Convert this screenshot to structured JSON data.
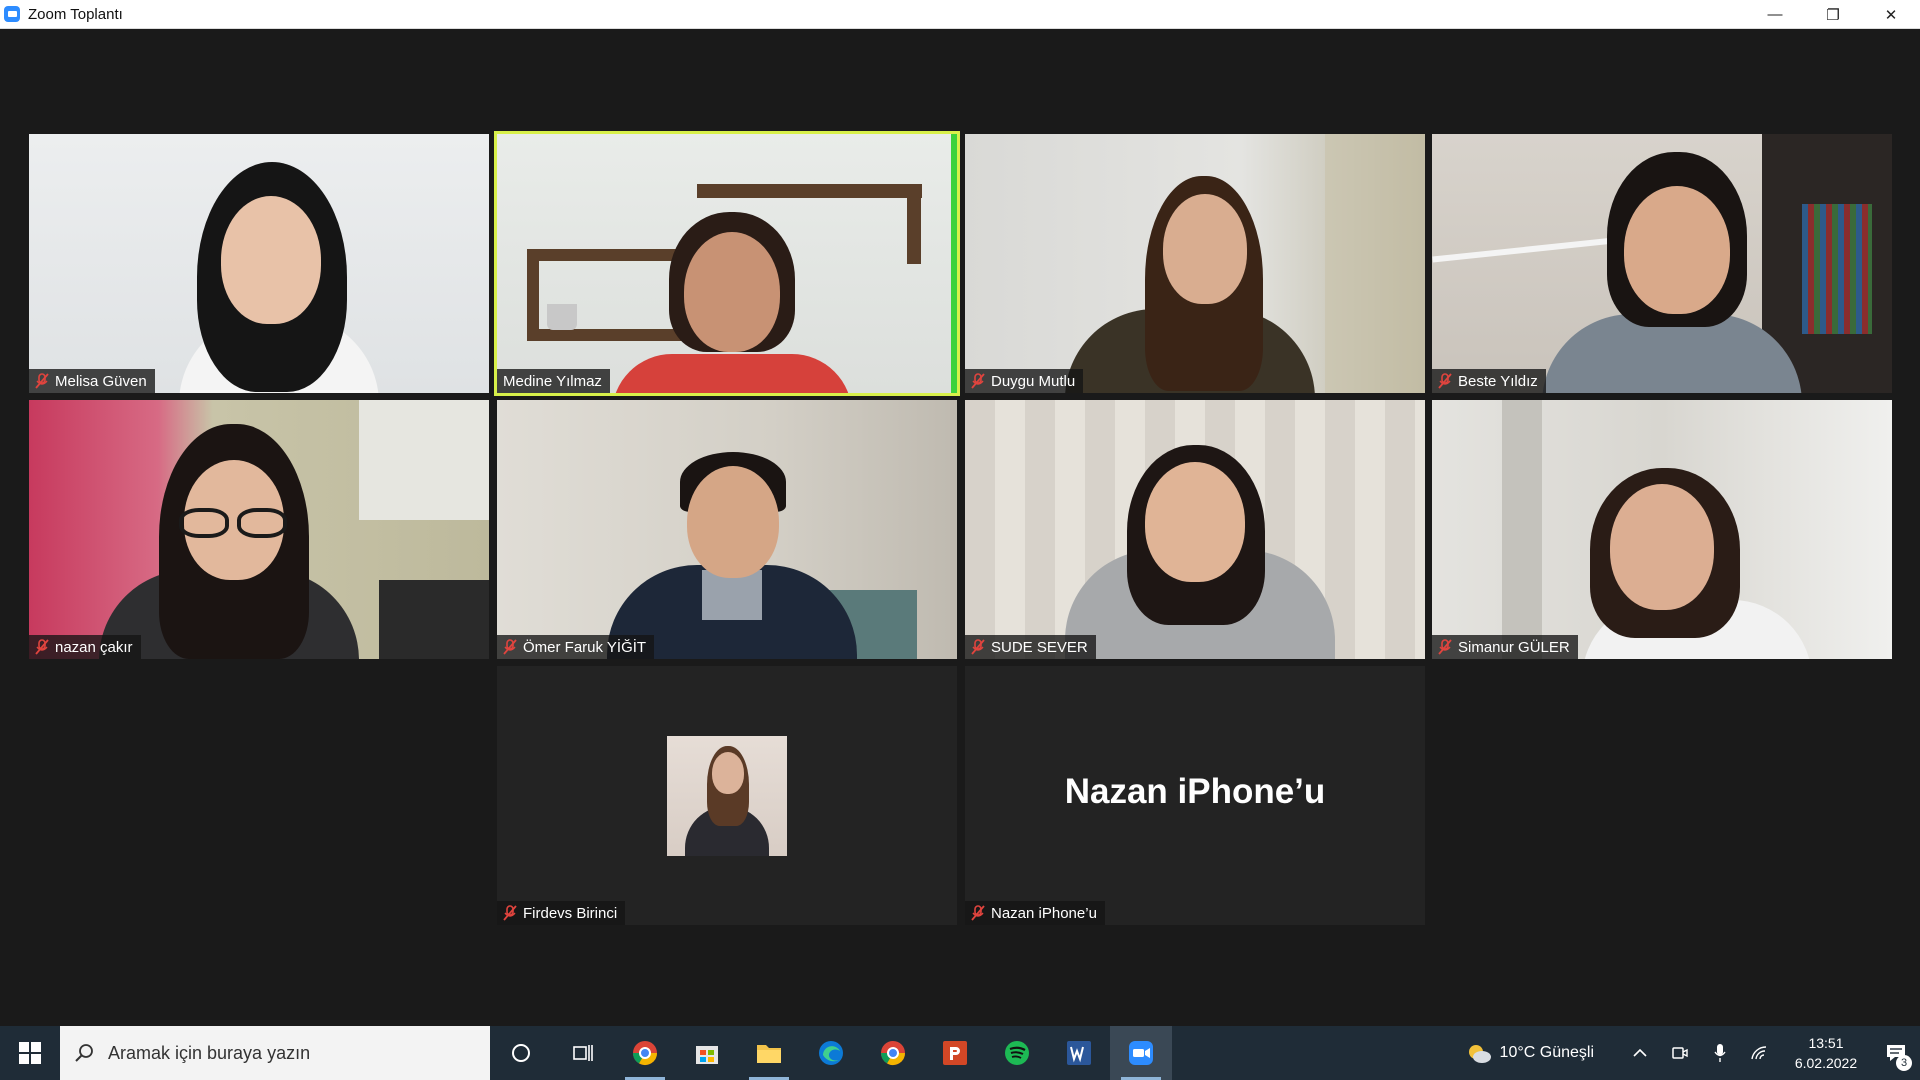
{
  "window": {
    "title": "Zoom Toplantı",
    "minimize": "—",
    "restore": "❐",
    "close": "✕"
  },
  "participants": [
    {
      "name": "Melisa Güven",
      "muted": true
    },
    {
      "name": "Medine  Yılmaz",
      "muted": false,
      "active_speaker": true
    },
    {
      "name": "Duygu Mutlu",
      "muted": true
    },
    {
      "name": "Beste Yıldız",
      "muted": true
    },
    {
      "name": "nazan çakır",
      "muted": true
    },
    {
      "name": "Ömer Faruk YİĞİT",
      "muted": true
    },
    {
      "name": "SUDE SEVER",
      "muted": true
    },
    {
      "name": "Simanur GÜLER",
      "muted": true
    },
    {
      "name": "Firdevs Birinci",
      "muted": true,
      "video": "off",
      "profile_picture": true
    },
    {
      "name": "Nazan iPhone’u",
      "muted": true,
      "video": "off",
      "display_text": "Nazan iPhone’u"
    }
  ],
  "taskbar": {
    "search_placeholder": "Aramak için buraya yazın",
    "apps": [
      "cortana-icon",
      "task-view-icon",
      "chrome-alt-icon",
      "store-icon",
      "file-explorer-icon",
      "edge-icon",
      "chrome-icon",
      "powerpoint-icon",
      "spotify-icon",
      "word-icon",
      "zoom-icon"
    ],
    "weather": "10°C  Güneşli",
    "time": "13:51",
    "date": "6.02.2022",
    "notifications": "3"
  },
  "colors": {
    "accent_active_speaker": "#d8f04a",
    "muted_icon": "#e0443e",
    "meeting_bg": "#1a1a1a",
    "taskbar_bg": "#1f2c37"
  }
}
